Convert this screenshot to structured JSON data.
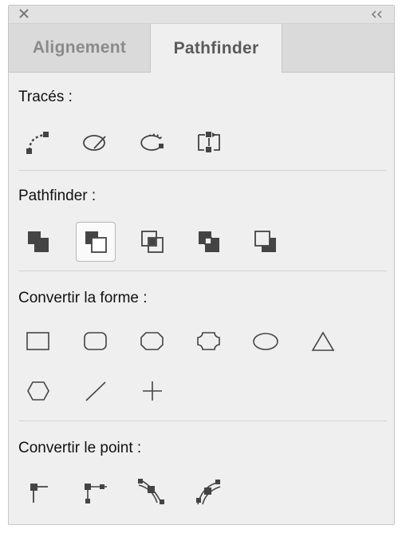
{
  "header": {
    "close_icon": "close-icon",
    "collapse_icon": "double-chevron-left-icon"
  },
  "tabs": [
    {
      "label": "Alignement",
      "active": false
    },
    {
      "label": "Pathfinder",
      "active": true
    }
  ],
  "sections": {
    "traces": {
      "title": "Tracés :",
      "buttons": [
        "open-path-icon",
        "close-path-icon",
        "reverse-path-icon",
        "split-path-icon"
      ]
    },
    "pathfinder": {
      "title": "Pathfinder :",
      "buttons": [
        "unite-icon",
        "minus-back-icon",
        "intersect-icon",
        "exclude-overlap-icon",
        "minus-front-icon"
      ],
      "selected": "minus-back-icon"
    },
    "convert_shape": {
      "title": "Convertir la forme :",
      "buttons": [
        "rectangle-icon",
        "rounded-rectangle-icon",
        "beveled-rectangle-icon",
        "inverse-rounded-rectangle-icon",
        "ellipse-icon",
        "triangle-icon",
        "polygon-icon",
        "line-icon",
        "orthogonal-line-icon"
      ]
    },
    "convert_point": {
      "title": "Convertir le point :",
      "buttons": [
        "plain-point-icon",
        "corner-point-icon",
        "smooth-point-icon",
        "symmetrical-smooth-point-icon"
      ]
    }
  },
  "colors": {
    "panel_bg": "#efefef",
    "icon": "#444444",
    "tab_inactive_bg": "#dadada"
  }
}
